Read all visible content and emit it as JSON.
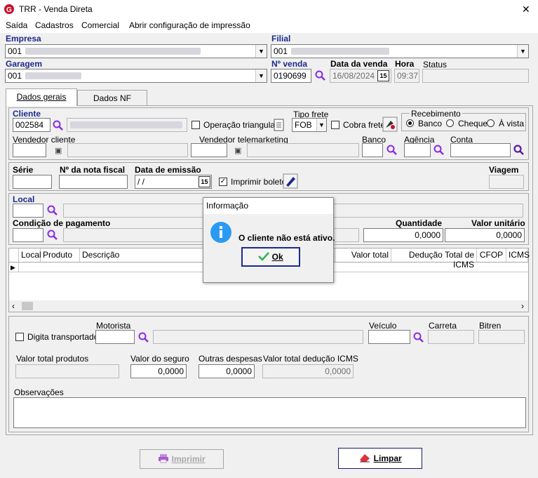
{
  "window": {
    "title": "TRR - Venda Direta",
    "close": "✕"
  },
  "menu": [
    "Saída",
    "Cadastros",
    "Comercial",
    "Abrir configuração de impressão"
  ],
  "header": {
    "empresa_label": "Empresa",
    "empresa_code": "001",
    "filial_label": "Filial",
    "filial_code": "001",
    "garagem_label": "Garagem",
    "garagem_code": "001",
    "nvenda_label": "Nº venda",
    "nvenda_value": "0190699",
    "data_label": "Data da venda",
    "data_value": "16/08/2024",
    "hora_label": "Hora",
    "hora_value": "09:37",
    "status_label": "Status"
  },
  "tabs": [
    "Dados gerais",
    "Dados NF"
  ],
  "cliente": {
    "label": "Cliente",
    "code": "002584",
    "operacao_triangular": "Operação triangular",
    "tipo_frete_label": "Tipo frete",
    "tipo_frete_value": "FOB",
    "cobra_frete": "Cobra frete",
    "recebimento_label": "Recebimento",
    "recebimento_options": [
      "Banco",
      "Cheque",
      "À vista"
    ],
    "vendedor_cliente": "Vendedor cliente",
    "vendedor_tele": "Vendedor telemarketing",
    "banco": "Banco",
    "agencia": "Agência",
    "conta": "Conta"
  },
  "nota": {
    "serie": "Série",
    "numero": "Nº da nota fiscal",
    "data_emissao": "Data de emissão",
    "data_value": " /  /",
    "imprimir_boleto": "Imprimir boleto",
    "viagem": "Viagem"
  },
  "local": {
    "label": "Local",
    "condicao": "Condição de pagamento",
    "quantidade_label": "Quantidade",
    "quantidade_value": "0,0000",
    "valor_unitario_label": "Valor unitário",
    "valor_unitario_value": "0,0000"
  },
  "grid": {
    "columns_left": [
      "Local",
      "Produto",
      "Descrição"
    ],
    "columns_right": [
      "Valor total",
      "Dedução Total de ICMS",
      "CFOP",
      "ICMS"
    ]
  },
  "transporte": {
    "digita": "Digita transportador",
    "motorista": "Motorista",
    "veiculo": "Veículo",
    "carreta": "Carreta",
    "bitren": "Bitren"
  },
  "totais": {
    "produtos_label": "Valor total produtos",
    "seguro_label": "Valor do seguro",
    "seguro_value": "0,0000",
    "despesas_label": "Outras despesas",
    "despesas_value": "0,0000",
    "deducao_label": "Valor total dedução ICMS",
    "deducao_value": "0,0000",
    "observacoes_label": "Observações"
  },
  "buttons": {
    "imprimir": "Imprimir",
    "limpar": "Limpar"
  },
  "dialog": {
    "title": "Informação",
    "message": "O cliente não está ativo.",
    "ok": "Ok"
  },
  "colors": {
    "accent": "#1a2a8c",
    "icon_purple": "#8a2be2",
    "info_blue": "#2b9af3",
    "ok_green": "#2fb24a"
  }
}
